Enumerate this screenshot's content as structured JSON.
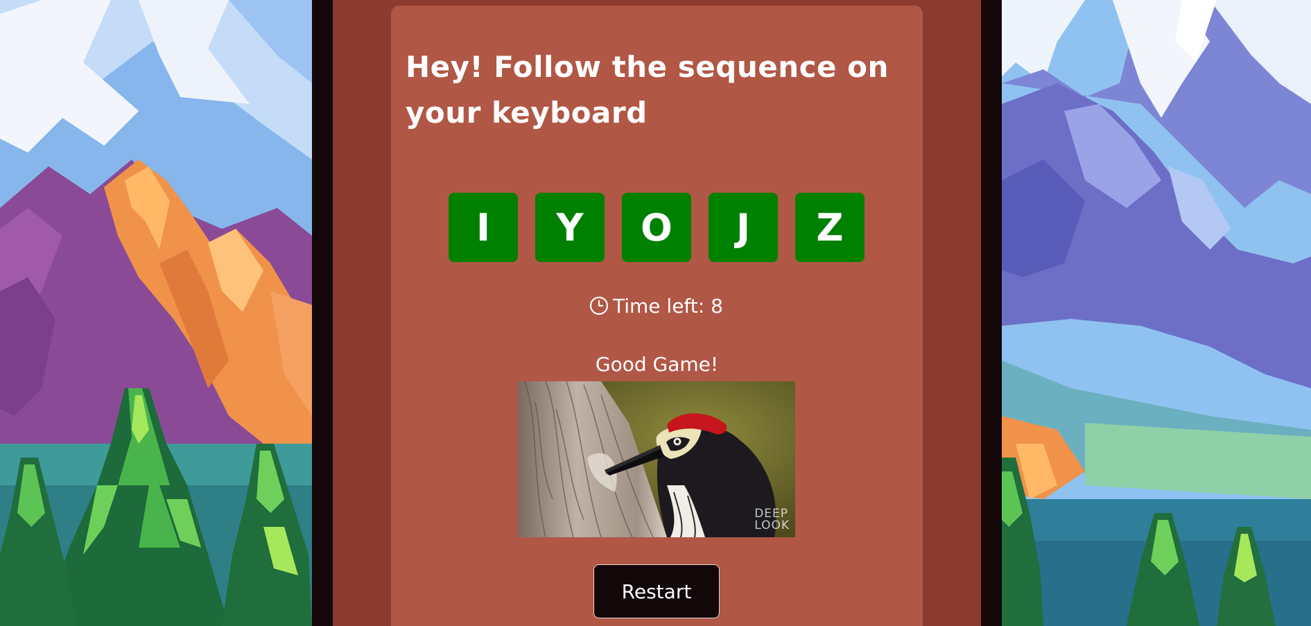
{
  "game": {
    "title": "Hey! Follow the sequence on your keyboard",
    "sequence": [
      "I",
      "Y",
      "O",
      "J",
      "Z"
    ],
    "timer_label": "Time left: 8",
    "message": "Good Game!",
    "image_watermark": [
      "DEEP",
      "LOOK"
    ],
    "restart_label": "Restart"
  },
  "icons": {
    "timer": "clock-icon"
  },
  "colors": {
    "key_tile": "#008000",
    "card": "#b15745",
    "column": "#8c3b2e",
    "frame": "#140709"
  }
}
